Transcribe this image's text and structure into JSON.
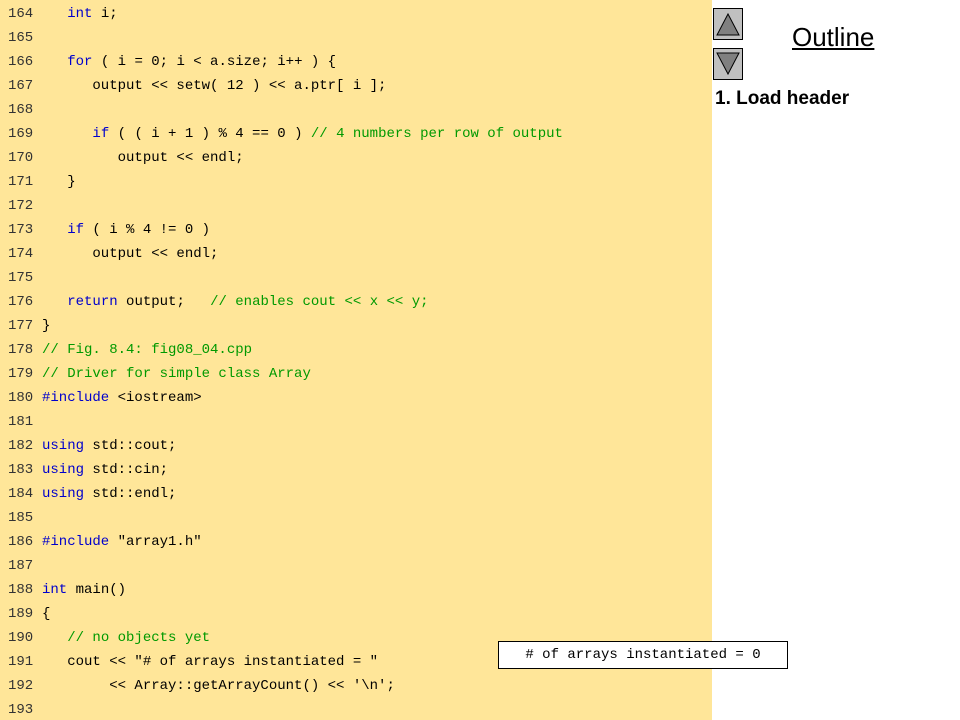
{
  "outline": {
    "title": "Outline",
    "step": "1. Load header",
    "up_button_icon": "triangle-up-icon",
    "down_button_icon": "triangle-down-icon"
  },
  "output_box": "# of arrays instantiated = 0",
  "colors": {
    "panel_background": "#ffe699",
    "keyword": "#0000cc",
    "comment": "#009900",
    "nav_button": "#c0c0c0"
  },
  "code_lines": [
    {
      "num": "164",
      "segments": [
        {
          "t": "   ",
          "c": ""
        },
        {
          "t": "int",
          "c": "kw"
        },
        {
          "t": " i;",
          "c": ""
        }
      ]
    },
    {
      "num": "165",
      "segments": []
    },
    {
      "num": "166",
      "segments": [
        {
          "t": "   ",
          "c": ""
        },
        {
          "t": "for",
          "c": "kw"
        },
        {
          "t": " ( i = 0; i < a.size; i++ ) {",
          "c": ""
        }
      ]
    },
    {
      "num": "167",
      "segments": [
        {
          "t": "      output << setw( 12 ) << a.ptr[ i ];",
          "c": ""
        }
      ]
    },
    {
      "num": "168",
      "segments": []
    },
    {
      "num": "169",
      "segments": [
        {
          "t": "      ",
          "c": ""
        },
        {
          "t": "if",
          "c": "kw"
        },
        {
          "t": " ( ( i + 1 ) % 4 == 0 ) ",
          "c": ""
        },
        {
          "t": "// 4 numbers per row of output",
          "c": "cm"
        }
      ]
    },
    {
      "num": "170",
      "segments": [
        {
          "t": "         output << endl;",
          "c": ""
        }
      ]
    },
    {
      "num": "171",
      "segments": [
        {
          "t": "   }",
          "c": ""
        }
      ]
    },
    {
      "num": "172",
      "segments": []
    },
    {
      "num": "173",
      "segments": [
        {
          "t": "   ",
          "c": ""
        },
        {
          "t": "if",
          "c": "kw"
        },
        {
          "t": " ( i % 4 != 0 )",
          "c": ""
        }
      ]
    },
    {
      "num": "174",
      "segments": [
        {
          "t": "      output << endl;",
          "c": ""
        }
      ]
    },
    {
      "num": "175",
      "segments": []
    },
    {
      "num": "176",
      "segments": [
        {
          "t": "   ",
          "c": ""
        },
        {
          "t": "return",
          "c": "kw"
        },
        {
          "t": " output;   ",
          "c": ""
        },
        {
          "t": "// enables cout << x << y;",
          "c": "cm"
        }
      ]
    },
    {
      "num": "177",
      "segments": [
        {
          "t": "}",
          "c": ""
        }
      ]
    },
    {
      "num": "178",
      "segments": [
        {
          "t": "// Fig. 8.4: fig08_04.cpp",
          "c": "cm"
        }
      ]
    },
    {
      "num": "179",
      "segments": [
        {
          "t": "// Driver for simple class Array",
          "c": "cm"
        }
      ]
    },
    {
      "num": "180",
      "segments": [
        {
          "t": "#include",
          "c": "kw"
        },
        {
          "t": " <iostream>",
          "c": ""
        }
      ]
    },
    {
      "num": "181",
      "segments": []
    },
    {
      "num": "182",
      "segments": [
        {
          "t": "using",
          "c": "kw"
        },
        {
          "t": " std::cout;",
          "c": ""
        }
      ]
    },
    {
      "num": "183",
      "segments": [
        {
          "t": "using",
          "c": "kw"
        },
        {
          "t": " std::cin;",
          "c": ""
        }
      ]
    },
    {
      "num": "184",
      "segments": [
        {
          "t": "using",
          "c": "kw"
        },
        {
          "t": " std::endl;",
          "c": ""
        }
      ]
    },
    {
      "num": "185",
      "segments": []
    },
    {
      "num": "186",
      "segments": [
        {
          "t": "#include",
          "c": "kw"
        },
        {
          "t": " \"array1.h\"",
          "c": ""
        }
      ]
    },
    {
      "num": "187",
      "segments": []
    },
    {
      "num": "188",
      "segments": [
        {
          "t": "int",
          "c": "kw"
        },
        {
          "t": " main()",
          "c": ""
        }
      ]
    },
    {
      "num": "189",
      "segments": [
        {
          "t": "{",
          "c": ""
        }
      ]
    },
    {
      "num": "190",
      "segments": [
        {
          "t": "   ",
          "c": ""
        },
        {
          "t": "// no objects yet",
          "c": "cm"
        }
      ]
    },
    {
      "num": "191",
      "segments": [
        {
          "t": "   cout << \"# of arrays instantiated = \"",
          "c": ""
        }
      ]
    },
    {
      "num": "192",
      "segments": [
        {
          "t": "        << Array::getArrayCount() << '\\n';",
          "c": ""
        }
      ]
    },
    {
      "num": "193",
      "segments": []
    }
  ]
}
